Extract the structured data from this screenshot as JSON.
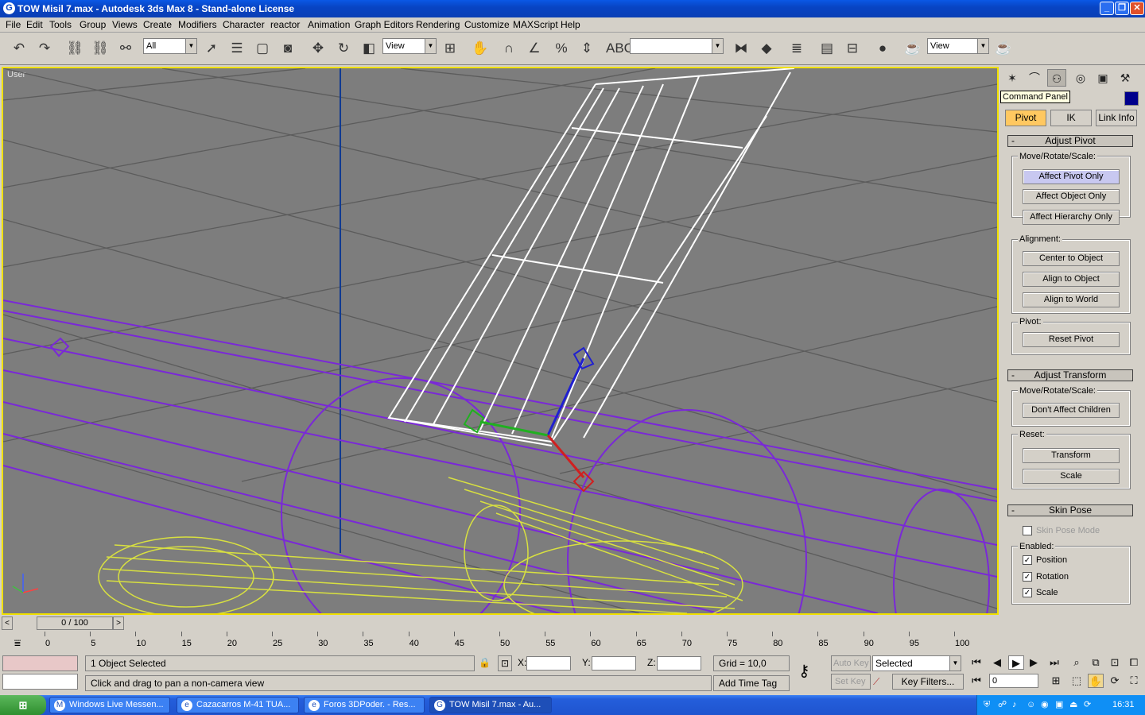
{
  "window": {
    "title": "TOW Misil 7.max - Autodesk 3ds Max 8  - Stand-alone License",
    "app_icon": "G",
    "buttons": {
      "minimize": "_",
      "maximize": "❐",
      "close": "✕"
    }
  },
  "menu": [
    "File",
    "Edit",
    "Tools",
    "Group",
    "Views",
    "Create",
    "Modifiers",
    "Character",
    "reactor",
    "Animation",
    "Graph Editors",
    "Rendering",
    "Customize",
    "MAXScript",
    "Help"
  ],
  "toolbar": {
    "selection_filter": "All",
    "ref_coord": "View",
    "named_selection": "",
    "render_type": "View"
  },
  "viewport": {
    "label": "User"
  },
  "command_panel": {
    "tooltip": "Command Panel",
    "tabs": [
      "Create",
      "Modify",
      "Hierarchy",
      "Motion",
      "Display",
      "Utilities"
    ],
    "subtabs": [
      "Pivot",
      "IK",
      "Link Info"
    ],
    "adjust_pivot": {
      "title": "Adjust Pivot",
      "move_label": "Move/Rotate/Scale:",
      "affect_pivot_only": "Affect Pivot Only",
      "affect_object_only": "Affect Object Only",
      "affect_hierarchy_only": "Affect Hierarchy Only",
      "alignment_label": "Alignment:",
      "center_to_object": "Center to Object",
      "align_to_object": "Align to Object",
      "align_to_world": "Align to World",
      "pivot_label": "Pivot:",
      "reset_pivot": "Reset Pivot"
    },
    "adjust_transform": {
      "title": "Adjust Transform",
      "move_label": "Move/Rotate/Scale:",
      "dont_affect_children": "Don't Affect Children",
      "reset_label": "Reset:",
      "transform": "Transform",
      "scale": "Scale"
    },
    "skin_pose": {
      "title": "Skin Pose",
      "skin_pose_mode": "Skin Pose Mode",
      "enabled_label": "Enabled:",
      "position": "Position",
      "rotation": "Rotation",
      "scale": "Scale"
    }
  },
  "timeline": {
    "frame_display": "0 / 100",
    "ticks": [
      "0",
      "5",
      "10",
      "15",
      "20",
      "25",
      "30",
      "35",
      "40",
      "45",
      "50",
      "55",
      "60",
      "65",
      "70",
      "75",
      "80",
      "85",
      "90",
      "95",
      "100"
    ]
  },
  "status": {
    "selection": "1 Object Selected",
    "prompt": "Click and drag to pan a non-camera view",
    "x_label": "X:",
    "y_label": "Y:",
    "z_label": "Z:",
    "grid": "Grid = 10,0",
    "add_time_tag": "Add Time Tag",
    "auto_key": "Auto Key",
    "set_key": "Set Key",
    "key_mode": "Selected",
    "key_filters": "Key Filters...",
    "current_frame": "0"
  },
  "taskbar": {
    "start": "⊞",
    "tasks": [
      {
        "label": "Windows Live Messen...",
        "icon": "M"
      },
      {
        "label": "Cazacarros M-41 TUA...",
        "icon": "e"
      },
      {
        "label": "Foros 3DPoder. - Res...",
        "icon": "e"
      },
      {
        "label": "TOW Misil 7.max - Au...",
        "icon": "G"
      }
    ],
    "clock": "16:31"
  }
}
